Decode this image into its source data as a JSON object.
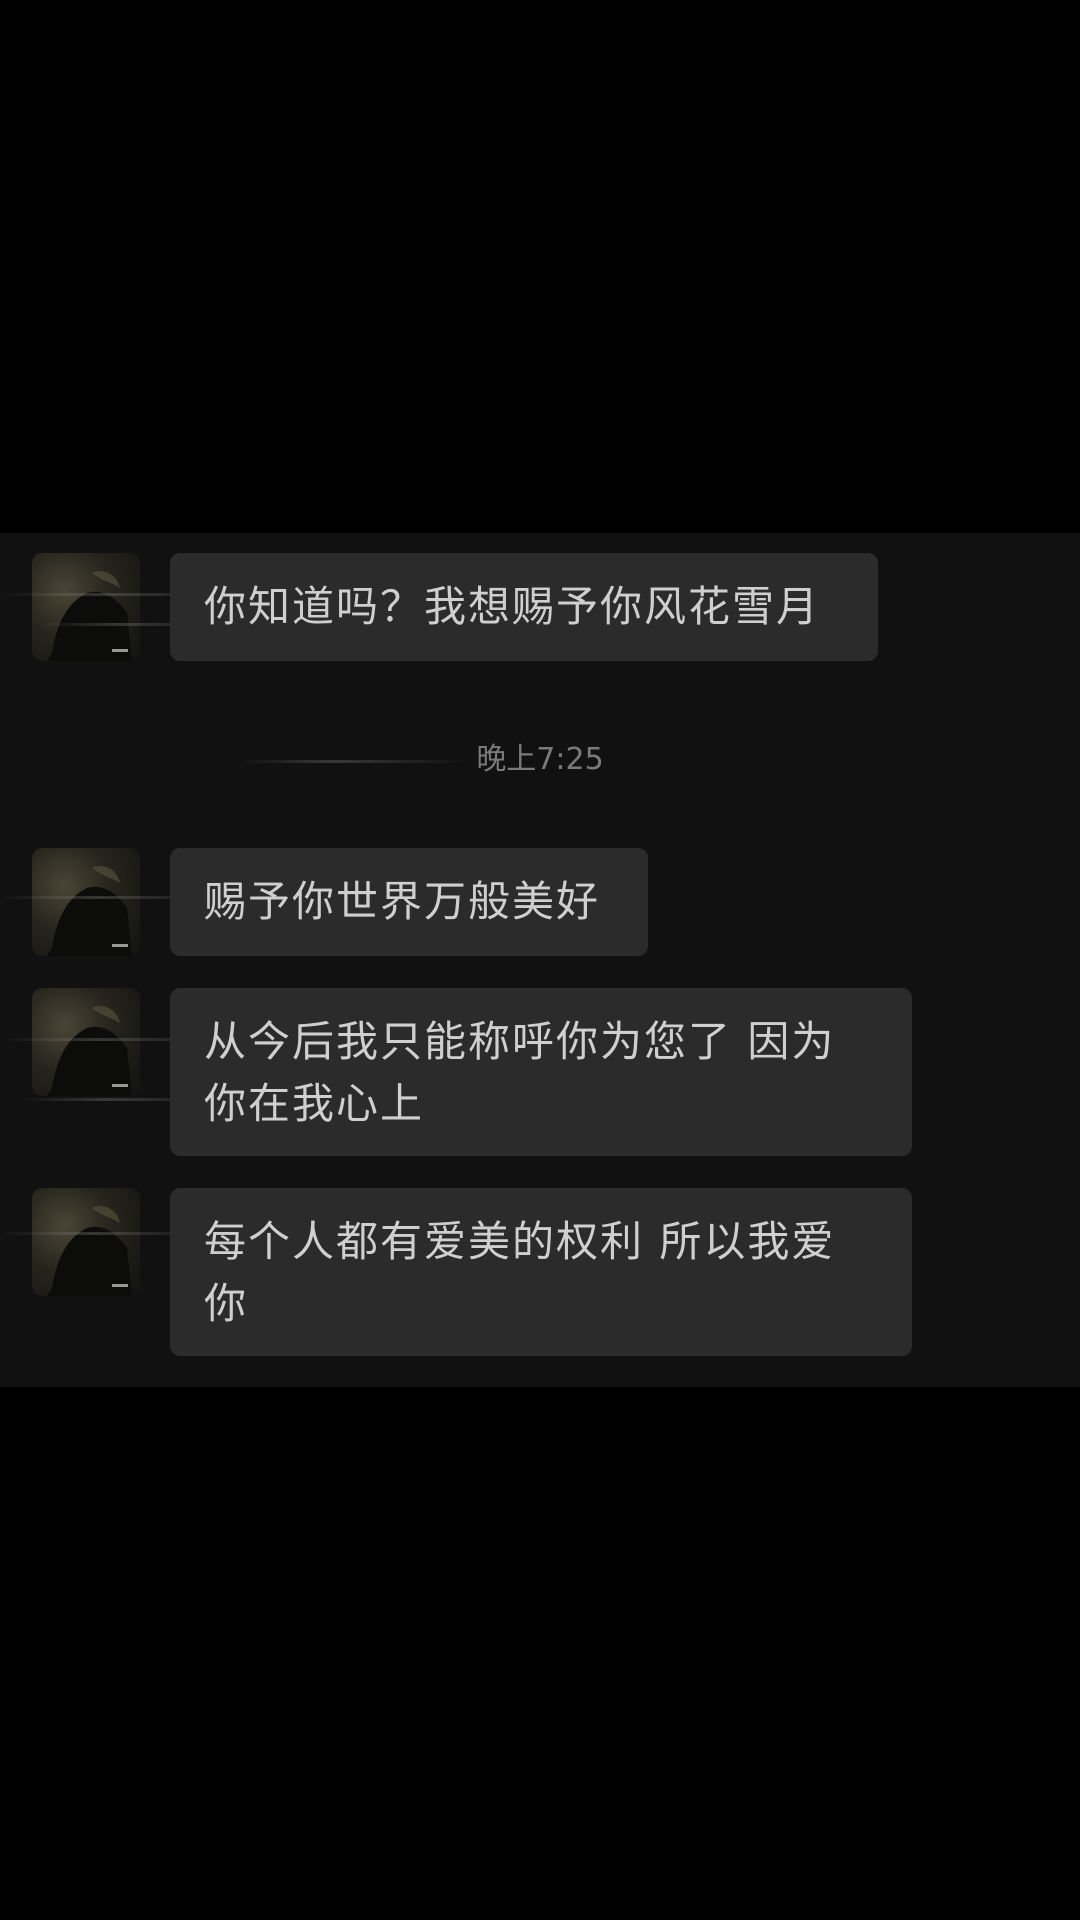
{
  "theme": {
    "background": "#000000",
    "panel": "#111111",
    "bubble": "#2b2b2b",
    "text": "#cfcfcf",
    "timestamp_text": "#7a7a7a"
  },
  "chat": {
    "messages": [
      {
        "sender": "other",
        "avatar_icon": "avatar-icon",
        "text": "你知道吗？我想赐予你风花雪月"
      },
      {
        "sender": "other",
        "avatar_icon": "avatar-icon",
        "text": "赐予你世界万般美好"
      },
      {
        "sender": "other",
        "avatar_icon": "avatar-icon",
        "text": "从今后我只能称呼你为您了 因为你在我心上"
      },
      {
        "sender": "other",
        "avatar_icon": "avatar-icon",
        "text": "每个人都有爱美的权利 所以我爱你"
      }
    ],
    "timestamp": "晚上7:25"
  }
}
